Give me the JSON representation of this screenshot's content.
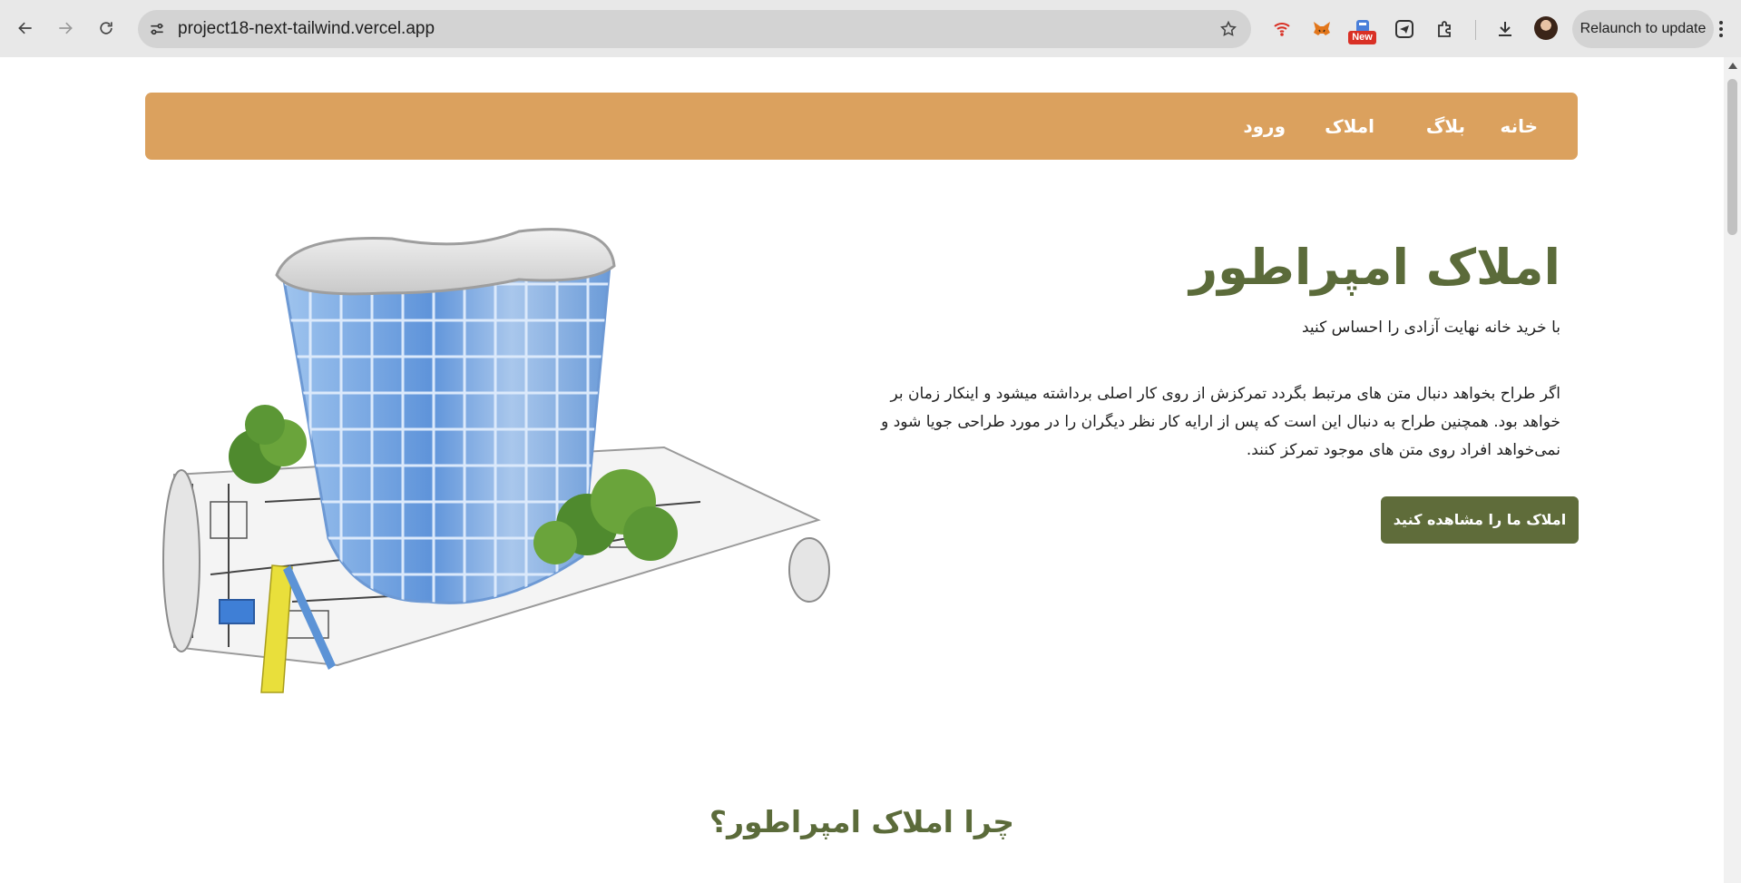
{
  "browser": {
    "url": "project18-next-tailwind.vercel.app",
    "new_badge": "New",
    "relaunch_label": "Relaunch to update",
    "icons": [
      "back-arrow-icon",
      "forward-arrow-icon",
      "reload-icon",
      "site-info-icon",
      "bookmark-star-icon",
      "wifi-extension-icon",
      "metamask-fox-icon",
      "new-extension-icon",
      "telegram-icon",
      "extensions-puzzle-icon",
      "download-icon",
      "avatar",
      "more-menu-icon"
    ]
  },
  "navbar": {
    "items": [
      {
        "label": "خانه"
      },
      {
        "label": "بلاگ"
      },
      {
        "label": "املاک"
      },
      {
        "label": "ورود"
      }
    ]
  },
  "hero": {
    "title": "املاک امپراطور",
    "subtitle": "با خرید خانه نهایت آزادی را احساس کنید",
    "body": "اگر طراح بخواهد دنبال متن های مرتبط بگردد تمرکزش از روی کار اصلی برداشته میشود و اینکار زمان بر خواهد بود. همچنین طراح به دنبال این است که پس از ارایه کار نظر دیگران را در مورد طراحی جویا شود و نمی‌خواهد افراد روی متن های موجود تمرکز کنند.",
    "cta_label": "املاک ما را مشاهده کنید"
  },
  "why_section": {
    "title": "چرا املاک امپراطور؟"
  },
  "colors": {
    "navbar_bg": "#dba15e",
    "accent_green": "#5b6b3a",
    "button_bg": "#5f6c3a"
  }
}
